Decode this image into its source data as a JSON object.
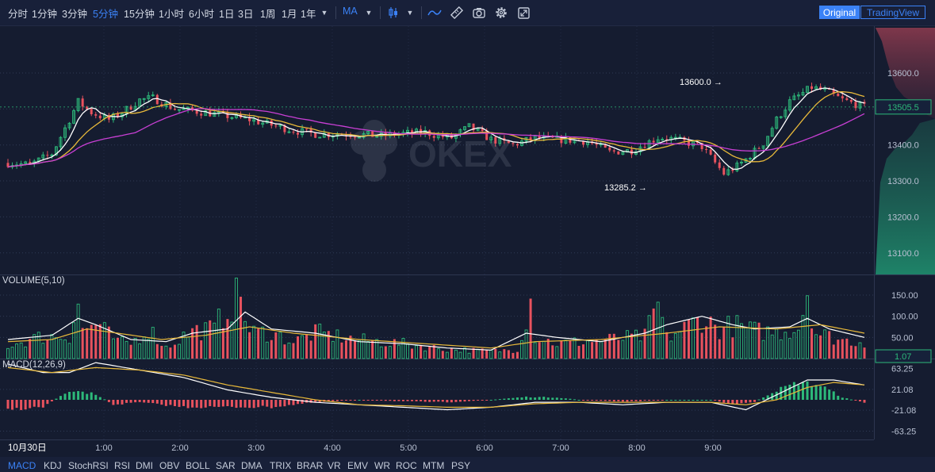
{
  "toolbar": {
    "timeframes": [
      "分时",
      "1分钟",
      "3分钟",
      "5分钟",
      "15分钟",
      "1小时",
      "6小时",
      "1日",
      "3日",
      "1周",
      "1月",
      "1年"
    ],
    "active_timeframe": "5分钟",
    "indicator_select": "MA",
    "icons": [
      "chevron-down-icon",
      "candle-type-icon",
      "line-study-icon",
      "ruler-icon",
      "camera-icon",
      "gear-icon",
      "fullscreen-icon"
    ],
    "original_label": "Original",
    "tradingview_label": "TradingView"
  },
  "panes": {
    "volume_title": "VOLUME(5,10)",
    "macd_title": "MACD(12,26,9)"
  },
  "bottom_indicators": [
    "MACD",
    "KDJ",
    "StochRSI",
    "RSI",
    "DMI",
    "OBV",
    "BOLL",
    "SAR",
    "DMA",
    "TRIX",
    "BRAR",
    "VR",
    "EMV",
    "WR",
    "ROC",
    "MTM",
    "PSY"
  ],
  "active_indicator": "MACD",
  "watermark": "OKEX",
  "colors": {
    "background": "#151c30",
    "up": "#2db97a",
    "down": "#e8525e",
    "ma_white": "#ffffff",
    "ma_yellow": "#e8b93a",
    "ma_magenta": "#c83fd4",
    "accent": "#3b82f6"
  },
  "chart_data": {
    "type": "candlestick",
    "date_label": "10月30日",
    "x_ticks": [
      "1:00",
      "2:00",
      "3:00",
      "4:00",
      "5:00",
      "6:00",
      "7:00",
      "8:00",
      "9:00"
    ],
    "price": {
      "ylim": [
        13040,
        13730
      ],
      "ticks": [
        "13600.0",
        "13500.0",
        "13400.0",
        "13300.0",
        "13200.0",
        "13100.0"
      ],
      "last_price": "13505.5",
      "high_label": "13600.0",
      "low_label": "13285.2",
      "anchors": [
        [
          0,
          13350
        ],
        [
          5,
          13345
        ],
        [
          10,
          13375
        ],
        [
          14,
          13470
        ],
        [
          16,
          13520
        ],
        [
          19,
          13490
        ],
        [
          23,
          13470
        ],
        [
          26,
          13490
        ],
        [
          30,
          13525
        ],
        [
          33,
          13530
        ],
        [
          38,
          13500
        ],
        [
          45,
          13490
        ],
        [
          50,
          13480
        ],
        [
          55,
          13470
        ],
        [
          60,
          13455
        ],
        [
          65,
          13440
        ],
        [
          70,
          13430
        ],
        [
          78,
          13430
        ],
        [
          85,
          13425
        ],
        [
          88,
          13430
        ],
        [
          95,
          13435
        ],
        [
          98,
          13425
        ],
        [
          101,
          13420
        ],
        [
          105,
          13450
        ],
        [
          110,
          13415
        ],
        [
          115,
          13400
        ],
        [
          120,
          13420
        ],
        [
          125,
          13415
        ],
        [
          132,
          13410
        ],
        [
          137,
          13380
        ],
        [
          142,
          13385
        ],
        [
          148,
          13420
        ],
        [
          150,
          13420
        ],
        [
          155,
          13405
        ],
        [
          158,
          13395
        ],
        [
          163,
          13320
        ],
        [
          166,
          13340
        ],
        [
          168,
          13360
        ],
        [
          172,
          13405
        ],
        [
          175,
          13470
        ],
        [
          178,
          13520
        ],
        [
          183,
          13560
        ],
        [
          186,
          13550
        ],
        [
          190,
          13525
        ],
        [
          195,
          13505
        ]
      ]
    },
    "volume": {
      "ticks": [
        "150.00",
        "100.00",
        "50.00"
      ],
      "last_value": "1.07",
      "ylim": [
        0,
        195
      ],
      "bars": [
        [
          0,
          35
        ],
        [
          8,
          60
        ],
        [
          14,
          60
        ],
        [
          16,
          155
        ],
        [
          17,
          75
        ],
        [
          20,
          95
        ],
        [
          25,
          45
        ],
        [
          28,
          40
        ],
        [
          32,
          80
        ],
        [
          36,
          30
        ],
        [
          42,
          75
        ],
        [
          47,
          80
        ],
        [
          50,
          140
        ],
        [
          53,
          170
        ],
        [
          55,
          70
        ],
        [
          60,
          70
        ],
        [
          65,
          45
        ],
        [
          70,
          70
        ],
        [
          80,
          50
        ],
        [
          90,
          40
        ],
        [
          100,
          25
        ],
        [
          110,
          20
        ],
        [
          116,
          25
        ],
        [
          119,
          160
        ],
        [
          120,
          60
        ],
        [
          125,
          40
        ],
        [
          135,
          50
        ],
        [
          145,
          60
        ],
        [
          148,
          145
        ],
        [
          150,
          55
        ],
        [
          158,
          110
        ],
        [
          162,
          80
        ],
        [
          165,
          90
        ],
        [
          170,
          75
        ],
        [
          175,
          70
        ],
        [
          180,
          85
        ],
        [
          182,
          185
        ],
        [
          184,
          70
        ],
        [
          187,
          60
        ],
        [
          190,
          50
        ],
        [
          195,
          45
        ]
      ],
      "ma5_anchors": [
        [
          0,
          45
        ],
        [
          10,
          55
        ],
        [
          16,
          95
        ],
        [
          20,
          80
        ],
        [
          28,
          45
        ],
        [
          36,
          40
        ],
        [
          42,
          60
        ],
        [
          50,
          70
        ],
        [
          54,
          110
        ],
        [
          60,
          70
        ],
        [
          70,
          60
        ],
        [
          80,
          40
        ],
        [
          90,
          35
        ],
        [
          100,
          25
        ],
        [
          110,
          20
        ],
        [
          118,
          60
        ],
        [
          125,
          50
        ],
        [
          135,
          40
        ],
        [
          145,
          60
        ],
        [
          150,
          80
        ],
        [
          158,
          100
        ],
        [
          165,
          80
        ],
        [
          170,
          70
        ],
        [
          178,
          75
        ],
        [
          182,
          95
        ],
        [
          187,
          70
        ],
        [
          195,
          50
        ]
      ],
      "ma10_anchors": [
        [
          0,
          40
        ],
        [
          10,
          45
        ],
        [
          18,
          70
        ],
        [
          25,
          60
        ],
        [
          35,
          45
        ],
        [
          45,
          55
        ],
        [
          55,
          75
        ],
        [
          65,
          60
        ],
        [
          80,
          45
        ],
        [
          95,
          35
        ],
        [
          110,
          25
        ],
        [
          120,
          40
        ],
        [
          135,
          45
        ],
        [
          150,
          60
        ],
        [
          162,
          75
        ],
        [
          175,
          70
        ],
        [
          185,
          80
        ],
        [
          195,
          60
        ]
      ]
    },
    "macd": {
      "ticks": [
        "63.25",
        "21.08",
        "-21.08",
        "-63.25"
      ],
      "ylim": [
        -80,
        80
      ],
      "dif_anchors": [
        [
          0,
          72
        ],
        [
          8,
          55
        ],
        [
          14,
          55
        ],
        [
          20,
          75
        ],
        [
          30,
          60
        ],
        [
          40,
          45
        ],
        [
          50,
          20
        ],
        [
          60,
          5
        ],
        [
          70,
          -5
        ],
        [
          80,
          -10
        ],
        [
          90,
          -15
        ],
        [
          100,
          -20
        ],
        [
          110,
          -15
        ],
        [
          120,
          -5
        ],
        [
          130,
          -5
        ],
        [
          140,
          -10
        ],
        [
          150,
          -5
        ],
        [
          160,
          -5
        ],
        [
          168,
          -20
        ],
        [
          175,
          10
        ],
        [
          182,
          40
        ],
        [
          188,
          40
        ],
        [
          195,
          30
        ]
      ],
      "dea_anchors": [
        [
          0,
          65
        ],
        [
          10,
          55
        ],
        [
          20,
          65
        ],
        [
          30,
          60
        ],
        [
          40,
          50
        ],
        [
          50,
          30
        ],
        [
          60,
          15
        ],
        [
          70,
          0
        ],
        [
          80,
          -10
        ],
        [
          90,
          -12
        ],
        [
          100,
          -15
        ],
        [
          110,
          -15
        ],
        [
          120,
          -8
        ],
        [
          130,
          -5
        ],
        [
          140,
          -5
        ],
        [
          150,
          -5
        ],
        [
          160,
          -5
        ],
        [
          168,
          -10
        ],
        [
          175,
          0
        ],
        [
          182,
          25
        ],
        [
          188,
          35
        ],
        [
          195,
          30
        ]
      ],
      "hist_anchors": [
        [
          0,
          -20
        ],
        [
          8,
          -15
        ],
        [
          14,
          20
        ],
        [
          20,
          12
        ],
        [
          24,
          -10
        ],
        [
          30,
          -5
        ],
        [
          40,
          -15
        ],
        [
          50,
          -15
        ],
        [
          60,
          -15
        ],
        [
          70,
          -5
        ],
        [
          80,
          0
        ],
        [
          90,
          -3
        ],
        [
          100,
          -5
        ],
        [
          110,
          0
        ],
        [
          118,
          6
        ],
        [
          125,
          5
        ],
        [
          130,
          0
        ],
        [
          140,
          -4
        ],
        [
          150,
          0
        ],
        [
          160,
          0
        ],
        [
          165,
          -10
        ],
        [
          170,
          -4
        ],
        [
          175,
          20
        ],
        [
          180,
          36
        ],
        [
          185,
          30
        ],
        [
          190,
          5
        ],
        [
          195,
          -6
        ]
      ]
    }
  }
}
